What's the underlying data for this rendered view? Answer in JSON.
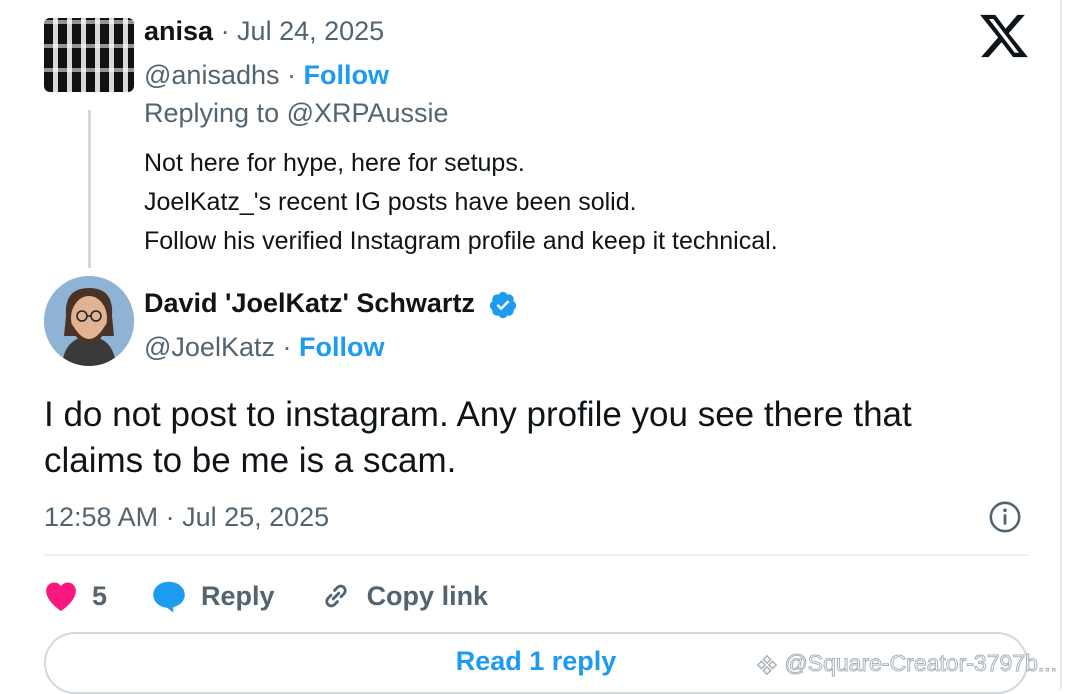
{
  "parent_tweet": {
    "name": "anisa",
    "date": "· Jul 24, 2025",
    "handle": "@anisadhs ·",
    "follow_label": "Follow",
    "replying_to": "Replying to @XRPAussie",
    "lines": [
      "Not here for hype,  here for setups.",
      "JoelKatz_'s recent IG posts have been solid.",
      "Follow his verified Instagram profile and keep it technical."
    ]
  },
  "main_tweet": {
    "name": "David 'JoelKatz' Schwartz",
    "handle": "@JoelKatz ·",
    "follow_label": "Follow",
    "lines": [
      "I do not post to instagram. Any profile you see there that",
      "claims to be me is a scam."
    ],
    "timestamp": "12:58 AM · Jul 25, 2025"
  },
  "actions": {
    "like_count": "5",
    "reply_label": "Reply",
    "copy_link_label": "Copy link"
  },
  "read_reply_label": "Read 1 reply",
  "watermark": "@Square-Creator-3797b...",
  "colors": {
    "accent": "#1d9bf0",
    "like": "#f91880",
    "muted_text": "#536471",
    "text": "#0f1419"
  },
  "icons": [
    "x-logo-icon",
    "verified-badge-icon",
    "info-icon",
    "heart-icon",
    "reply-bubble-icon",
    "link-icon",
    "binance-square-icon"
  ]
}
